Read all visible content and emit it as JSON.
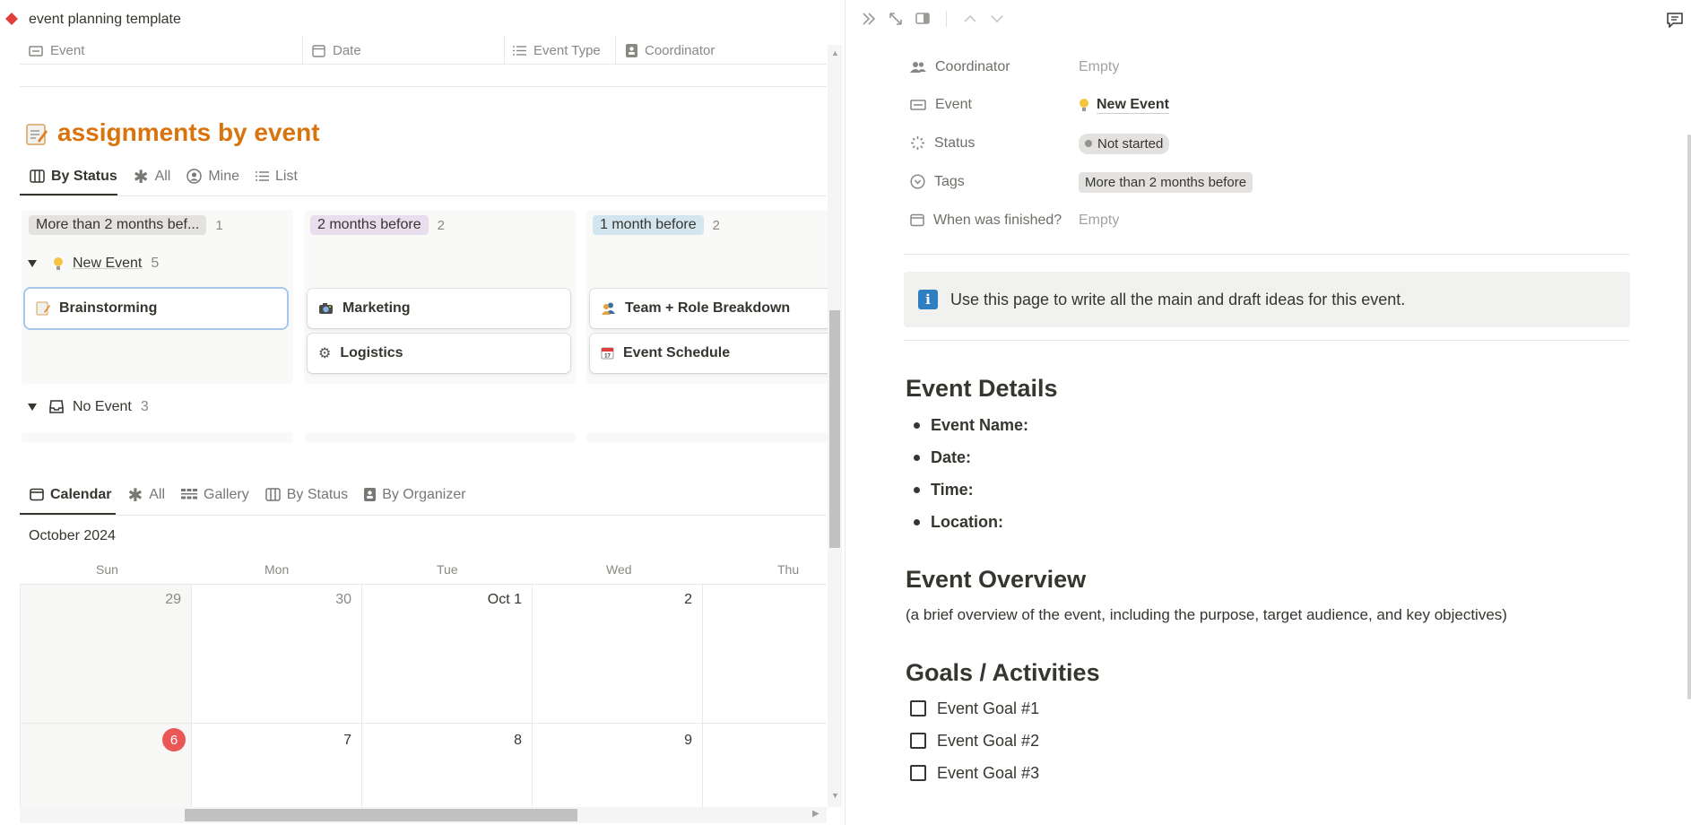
{
  "left": {
    "page_title": "event planning template",
    "db_columns": [
      "Event",
      "Date",
      "Event Type",
      "Coordinator"
    ],
    "section_title": "assignments by event",
    "board_tabs": [
      {
        "label": "By Status",
        "icon": "board-icon",
        "active": true
      },
      {
        "label": "All",
        "icon": "asterisk-icon",
        "active": false
      },
      {
        "label": "Mine",
        "icon": "person-circle-icon",
        "active": false
      },
      {
        "label": "List",
        "icon": "list-icon",
        "active": false
      }
    ],
    "board_columns": [
      {
        "label": "More than 2 months bef...",
        "count": "1",
        "color": "#e3e2e0"
      },
      {
        "label": "2 months before",
        "count": "2",
        "color": "#e8deee"
      },
      {
        "label": "1 month before",
        "count": "2",
        "color": "#d3e5ef"
      }
    ],
    "groups": [
      {
        "label": "New Event",
        "count": "5",
        "icon": "lightbulb-icon"
      },
      {
        "label": "No Event",
        "count": "3",
        "icon": "inbox-icon"
      }
    ],
    "cards": [
      {
        "label": "Brainstorming",
        "icon": "memo-icon"
      },
      {
        "label": "Marketing",
        "icon": "camera-icon"
      },
      {
        "label": "Logistics",
        "icon": "gear-icon"
      },
      {
        "label": "Team + Role Breakdown",
        "icon": "people-icon"
      },
      {
        "label": "Event Schedule",
        "icon": "calendar-icon"
      }
    ],
    "calendar_tabs": [
      {
        "label": "Calendar",
        "icon": "calendar-icon",
        "active": true
      },
      {
        "label": "All",
        "icon": "asterisk-icon",
        "active": false
      },
      {
        "label": "Gallery",
        "icon": "gallery-icon",
        "active": false
      },
      {
        "label": "By Status",
        "icon": "board-icon",
        "active": false
      },
      {
        "label": "By Organizer",
        "icon": "contact-icon",
        "active": false
      }
    ],
    "month_label": "October 2024",
    "weekdays": [
      "Sun",
      "Mon",
      "Tue",
      "Wed",
      "Thu"
    ],
    "week1": [
      "29",
      "30",
      "Oct 1",
      "2"
    ],
    "week2": [
      "6",
      "7",
      "8",
      "9"
    ]
  },
  "right": {
    "properties": [
      {
        "label": "Coordinator",
        "icon": "people-icon",
        "value": "Empty"
      },
      {
        "label": "Event",
        "icon": "ticket-icon",
        "value": "New Event"
      },
      {
        "label": "Status",
        "icon": "status-icon",
        "value": "Not started"
      },
      {
        "label": "Tags",
        "icon": "tag-icon",
        "value": "More than 2 months before"
      },
      {
        "label": "When was finished?",
        "icon": "calendar-icon",
        "value": "Empty"
      }
    ],
    "callout": "Use this page to write all the main and draft ideas for this event.",
    "h_details": "Event Details",
    "details_items": [
      "Event Name:",
      "Date:",
      "Time:",
      "Location:"
    ],
    "h_overview": "Event Overview",
    "overview_text": "(a brief overview of the event, including the purpose, target audience, and key objectives)",
    "h_goals": "Goals / Activities",
    "goals": [
      "Event Goal #1",
      "Event Goal #2",
      "Event Goal #3"
    ]
  }
}
